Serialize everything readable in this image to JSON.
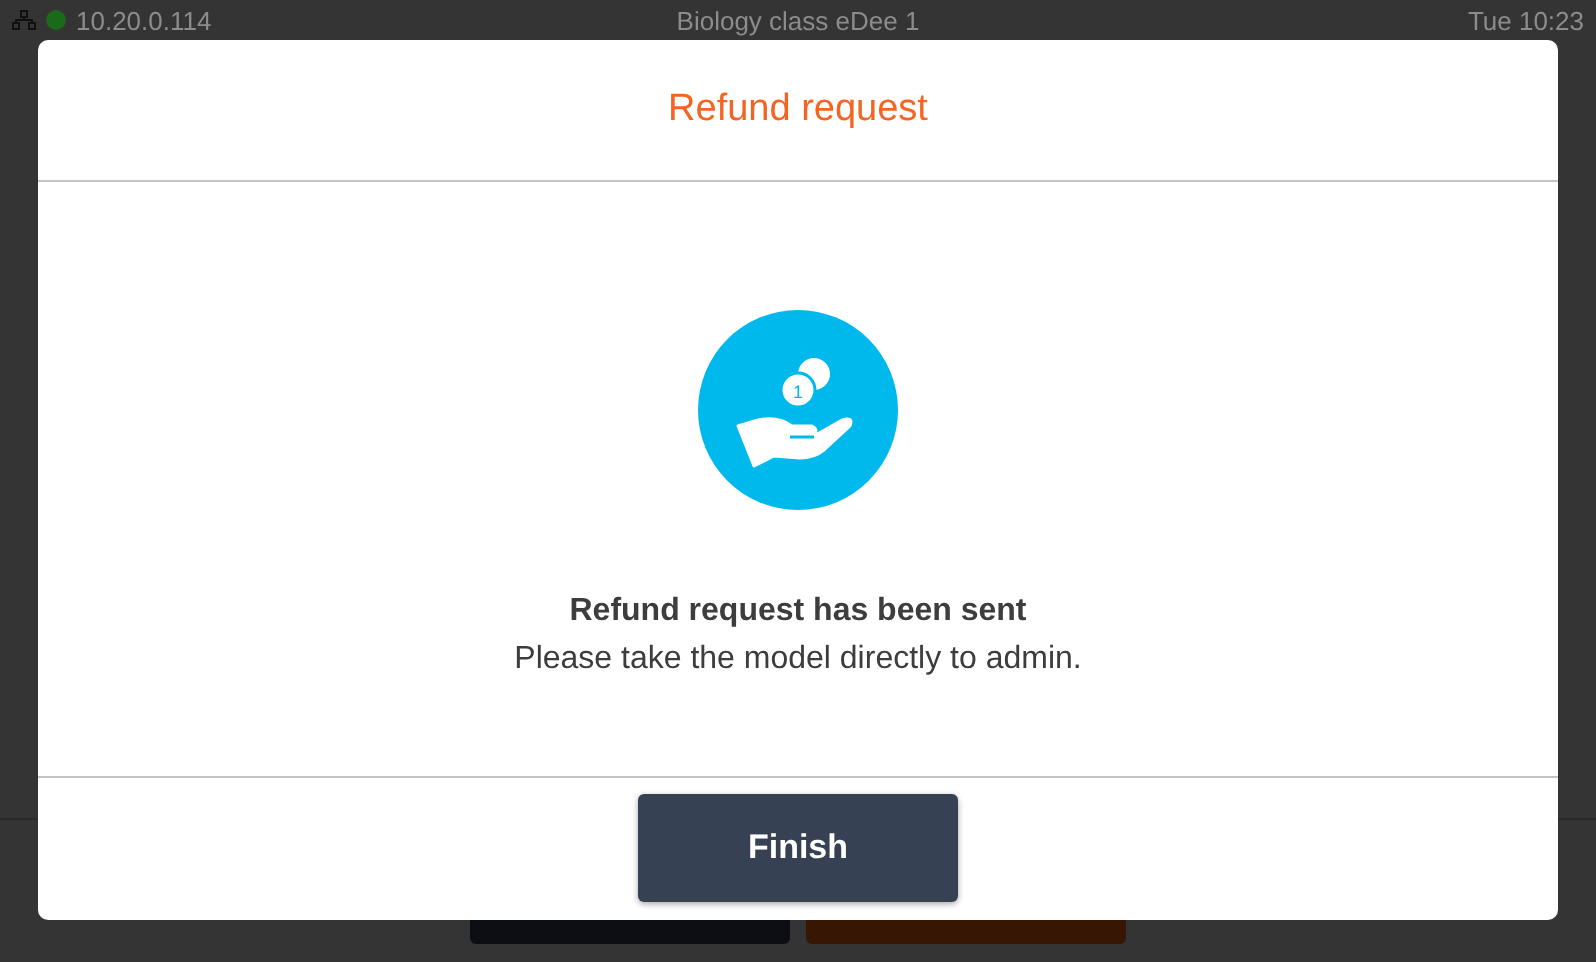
{
  "status_bar": {
    "connected": true,
    "ip": "10.20.0.114",
    "title": "Biology class eDee 1",
    "time": "Tue 10:23"
  },
  "dialog": {
    "title": "Refund request",
    "coin_label": "1",
    "message_title": "Refund request has been sent",
    "message": "Please take the model directly to admin.",
    "button": "Finish"
  }
}
